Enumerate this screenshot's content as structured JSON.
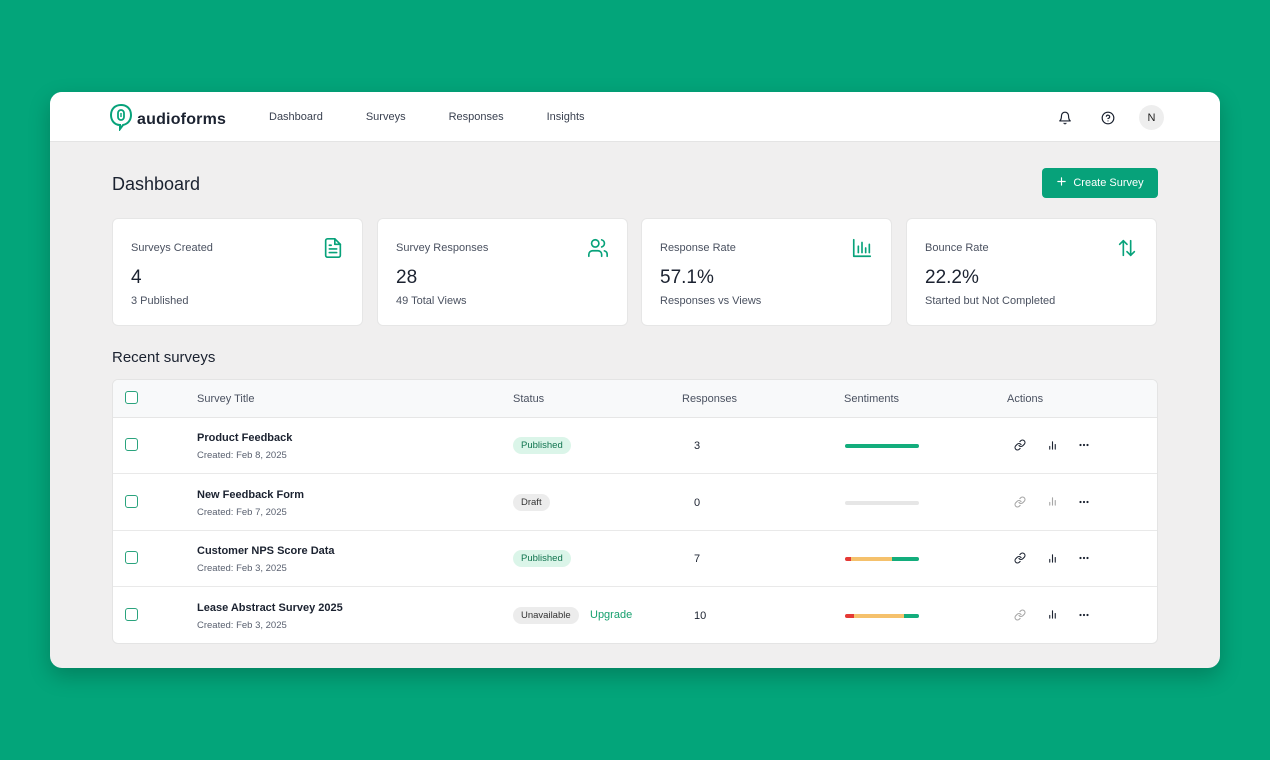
{
  "brand": {
    "name": "audioforms",
    "accent": "#07a27a",
    "background": "#03a57a"
  },
  "nav": {
    "items": [
      "Dashboard",
      "Surveys",
      "Responses",
      "Insights"
    ]
  },
  "header_icons": [
    "bell-icon",
    "help-icon"
  ],
  "user": {
    "avatar_initial": "N"
  },
  "page": {
    "title": "Dashboard",
    "create_button": "Create Survey"
  },
  "stats": [
    {
      "label": "Surveys Created",
      "value": "4",
      "sub": "3 Published",
      "icon": "document-icon"
    },
    {
      "label": "Survey Responses",
      "value": "28",
      "sub": "49 Total Views",
      "icon": "users-icon"
    },
    {
      "label": "Response Rate",
      "value": "57.1%",
      "sub": "Responses vs Views",
      "icon": "bar-chart-icon"
    },
    {
      "label": "Bounce Rate",
      "value": "22.2%",
      "sub": "Started but Not Completed",
      "icon": "arrows-up-down-icon"
    }
  ],
  "recent": {
    "title": "Recent surveys",
    "columns": [
      "Survey Title",
      "Status",
      "Responses",
      "Sentiments",
      "Actions"
    ],
    "rows": [
      {
        "title": "Product Feedback",
        "created": "Created: Feb 8, 2025",
        "status": "Published",
        "responses": "3",
        "sentiment": {
          "negative": 0,
          "neutral": 0,
          "positive": 100
        },
        "actions_enabled": true
      },
      {
        "title": "New Feedback Form",
        "created": "Created: Feb 7, 2025",
        "status": "Draft",
        "responses": "0",
        "sentiment": {
          "negative": 0,
          "neutral": 0,
          "positive": 0
        },
        "actions_enabled": false
      },
      {
        "title": "Customer NPS Score Data",
        "created": "Created: Feb 3, 2025",
        "status": "Published",
        "responses": "7",
        "sentiment": {
          "negative": 8,
          "neutral": 56,
          "positive": 36
        },
        "actions_enabled": true
      },
      {
        "title": "Lease Abstract Survey 2025",
        "created": "Created: Feb 3, 2025",
        "status": "Unavailable",
        "upgrade": "Upgrade",
        "responses": "10",
        "sentiment": {
          "negative": 12,
          "neutral": 68,
          "positive": 20
        },
        "actions_enabled": false
      }
    ]
  },
  "sentiment_colors": {
    "negative": "#e53935",
    "neutral": "#f5c16c",
    "positive": "#13ad7c",
    "empty": "#e6e6e6"
  }
}
